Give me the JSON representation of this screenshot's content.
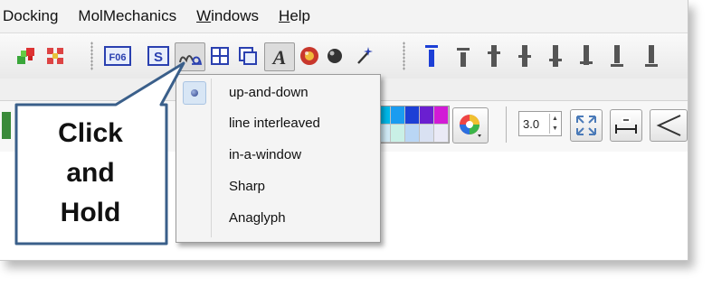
{
  "menubar": {
    "items": [
      {
        "label": "Docking"
      },
      {
        "label": "MolMechanics"
      },
      {
        "label": "Windows"
      },
      {
        "label": "Help"
      }
    ]
  },
  "toolbar": {
    "f06_label": "F06",
    "s_label": "S",
    "a_label": "A"
  },
  "stereo_menu": {
    "selected": "up-and-down",
    "items": [
      {
        "label": "up-and-down"
      },
      {
        "label": "line interleaved"
      },
      {
        "label": "in-a-window"
      },
      {
        "label": "Sharp"
      },
      {
        "label": "Anaglyph"
      }
    ]
  },
  "spinner": {
    "value": "3.0"
  },
  "callout": {
    "line1": "Click",
    "line2": "and",
    "line3": "Hold"
  },
  "colors": {
    "accent_blue": "#1c3fd6",
    "callout_border": "#3a5f8a",
    "menu_highlight": "#d8e6f5"
  }
}
